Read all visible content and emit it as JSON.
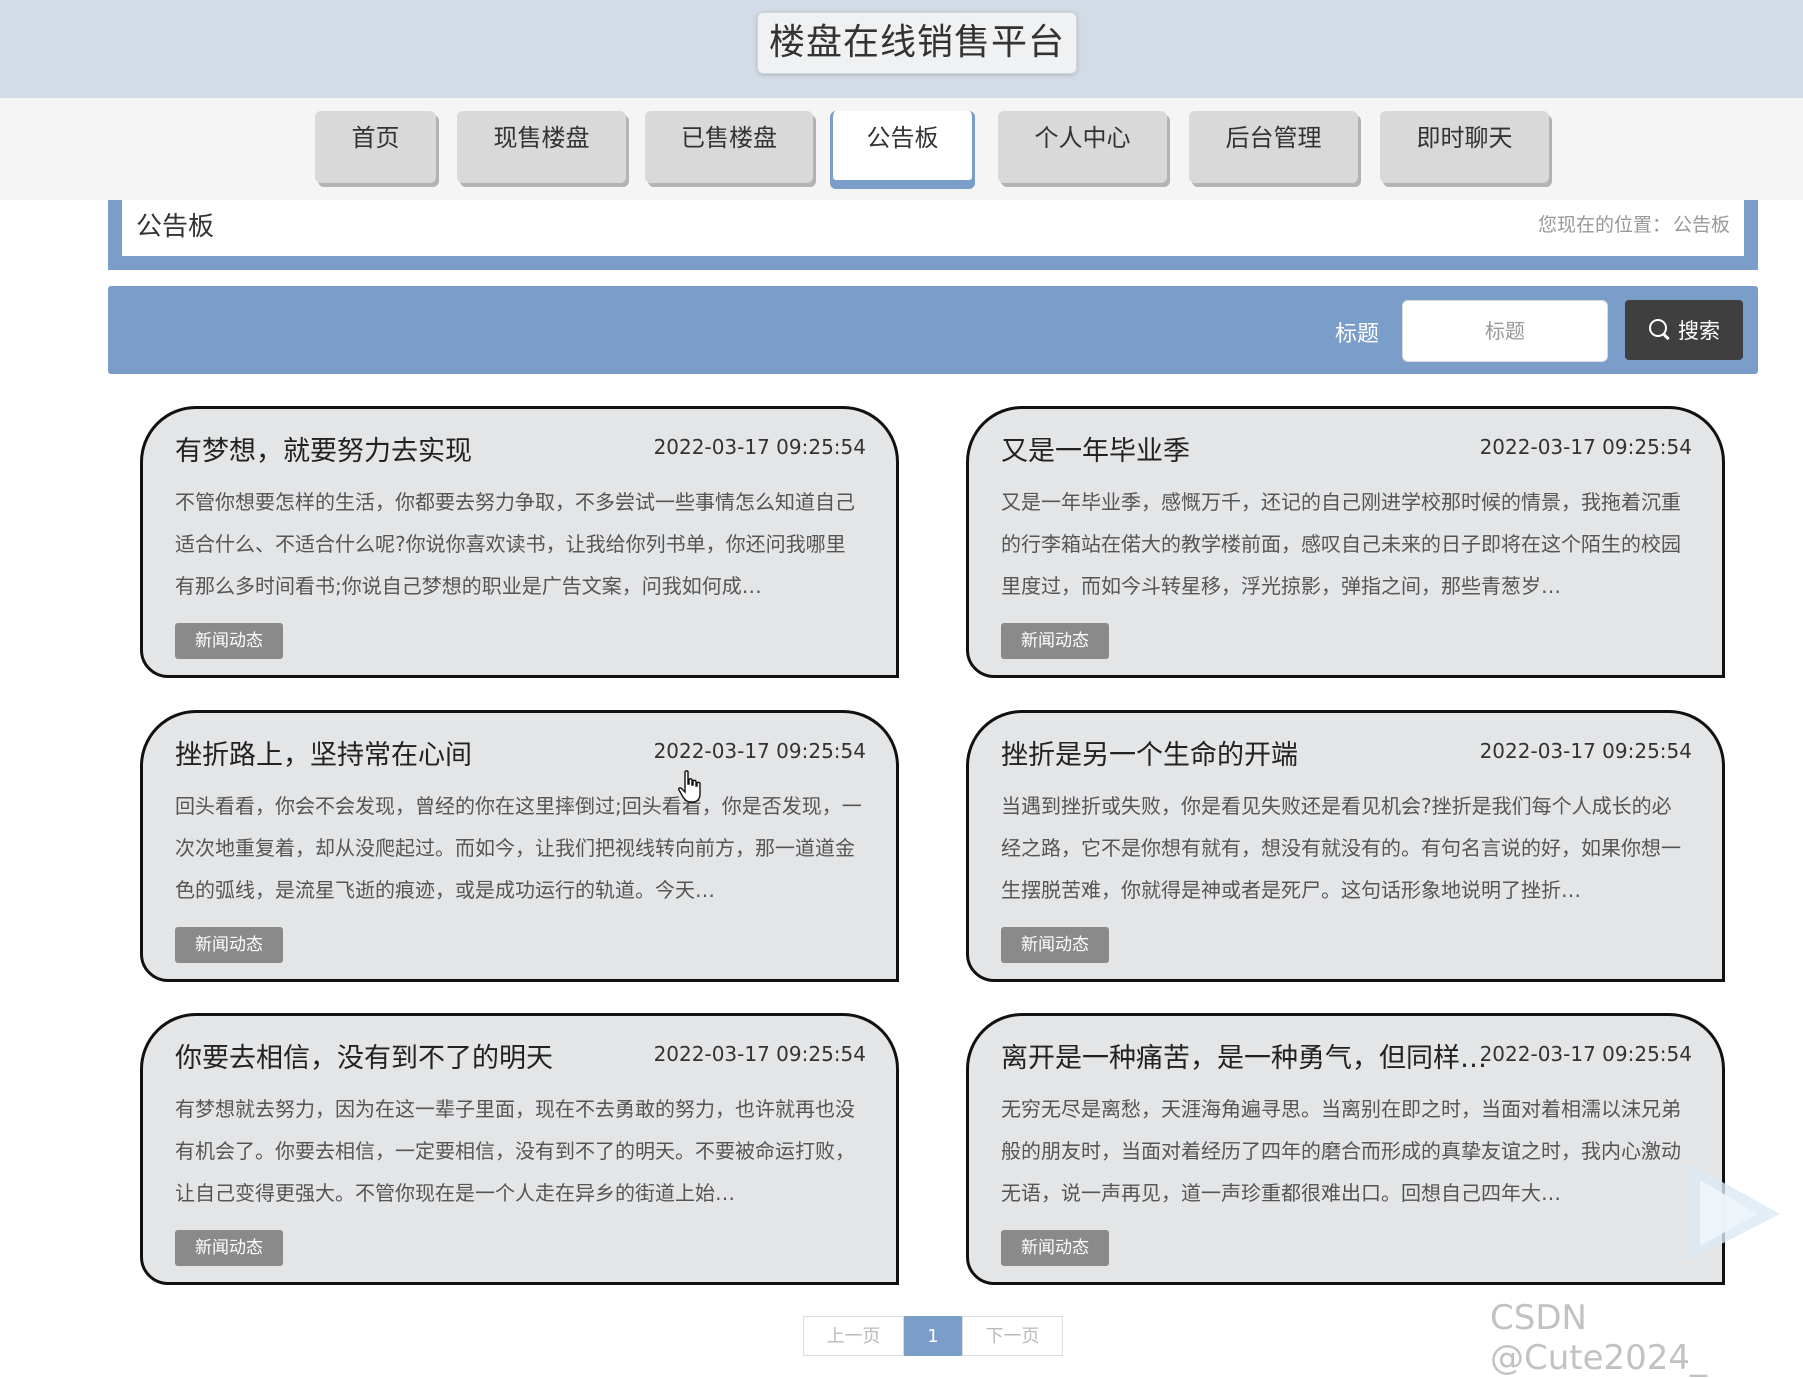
{
  "header": {
    "site_title": "楼盘在线销售平台"
  },
  "nav": {
    "items": [
      {
        "label": "首页"
      },
      {
        "label": "现售楼盘"
      },
      {
        "label": "已售楼盘"
      },
      {
        "label": "公告板"
      },
      {
        "label": "个人中心"
      },
      {
        "label": "后台管理"
      },
      {
        "label": "即时聊天"
      }
    ],
    "active": "公告板"
  },
  "breadcrumb": {
    "title": "公告板",
    "location_prefix": "您现在的位置：",
    "location": "公告板"
  },
  "search": {
    "label": "标题",
    "placeholder": "标题",
    "button_label": "搜索"
  },
  "cards": [
    {
      "title": "有梦想，就要努力去实现",
      "date": "2022-03-17 09:25:54",
      "summary": "不管你想要怎样的生活，你都要去努力争取，不多尝试一些事情怎么知道自己适合什么、不适合什么呢?你说你喜欢读书，让我给你列书单，你还问我哪里有那么多时间看书;你说自己梦想的职业是广告文案，问我如何成…",
      "tag": "新闻动态"
    },
    {
      "title": "又是一年毕业季",
      "date": "2022-03-17 09:25:54",
      "summary": "又是一年毕业季，感慨万千，还记的自己刚进学校那时候的情景，我拖着沉重的行李箱站在偌大的教学楼前面，感叹自己未来的日子即将在这个陌生的校园里度过，而如今斗转星移，浮光掠影，弹指之间，那些青葱岁…",
      "tag": "新闻动态"
    },
    {
      "title": "挫折路上，坚持常在心间",
      "date": "2022-03-17 09:25:54",
      "summary": "回头看看，你会不会发现，曾经的你在这里摔倒过;回头看看，你是否发现，一次次地重复着，却从没爬起过。而如今，让我们把视线转向前方，那一道道金色的弧线，是流星飞逝的痕迹，或是成功运行的轨道。今天…",
      "tag": "新闻动态"
    },
    {
      "title": "挫折是另一个生命的开端",
      "date": "2022-03-17 09:25:54",
      "summary": "当遇到挫折或失败，你是看见失败还是看见机会?挫折是我们每个人成长的必经之路，它不是你想有就有，想没有就没有的。有句名言说的好，如果你想一生摆脱苦难，你就得是神或者是死尸。这句话形象地说明了挫折…",
      "tag": "新闻动态"
    },
    {
      "title": "你要去相信，没有到不了的明天",
      "date": "2022-03-17 09:25:54",
      "summary": "有梦想就去努力，因为在这一辈子里面，现在不去勇敢的努力，也许就再也没有机会了。你要去相信，一定要相信，没有到不了的明天。不要被命运打败，让自己变得更强大。不管你现在是一个人走在异乡的街道上始…",
      "tag": "新闻动态"
    },
    {
      "title": "离开是一种痛苦，是一种勇气，但同样…",
      "date": "2022-03-17 09:25:54",
      "summary": "无穷无尽是离愁，天涯海角遍寻思。当离别在即之时，当面对着相濡以沫兄弟般的朋友时，当面对着经历了四年的磨合而形成的真挚友谊之时，我内心激动无语，说一声再见，道一声珍重都很难出口。回想自己四年大…",
      "tag": "新闻动态"
    }
  ],
  "pagination": {
    "prev": "上一页",
    "current": "1",
    "next": "下一页"
  },
  "watermark": "CSDN @Cute2024_",
  "colors": {
    "accent": "#7b9dc9",
    "header_bg": "#d3dce6",
    "card_bg": "#e4e5e7",
    "button_dark": "#3f3f3f"
  },
  "icons": [
    "search-icon",
    "pointer-cursor-icon",
    "play-icon"
  ]
}
